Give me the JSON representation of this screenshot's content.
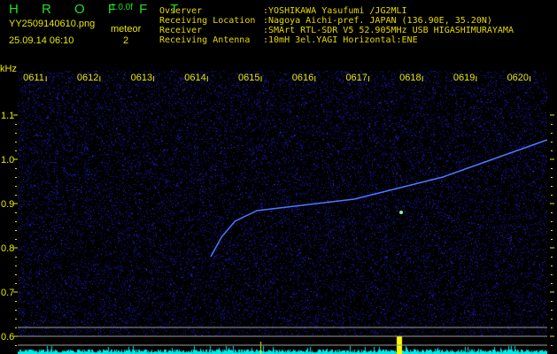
{
  "header": {
    "app": "H R O F F T",
    "version": "1.0.0f",
    "filename": "YY2509140610.png",
    "datetime": "25.09.14 06:10",
    "meteor_label": "meteor",
    "meteor_count": "2",
    "info": [
      {
        "label": "Ovserver",
        "value": ":YOSHIKAWA Yasufumi /JG2MLI"
      },
      {
        "label": "Receiving Location",
        "value": ":Nagoya Aichi-pref. JAPAN (136.90E, 35.20N)"
      },
      {
        "label": "Receiver",
        "value": ":SMArt RTL-SDR V5 52.905MHz USB HIGASHIMURAYAMA"
      },
      {
        "label": "Receiving Antenna",
        "value": ":10mH 3el.YAGI Horizontal:ENE"
      }
    ]
  },
  "colors": {
    "background": "#000000",
    "noise": "#1a1aa0",
    "trace": "#4a7aff",
    "text": "#e8e800",
    "histogram": "#00e8e8"
  },
  "chart_data": {
    "type": "heatmap",
    "ylabel": "kHz",
    "ylim": [
      0.56,
      1.2
    ],
    "yticks": [
      "1.1",
      "1.0",
      "0.9",
      "0.8",
      "0.7",
      "0.6"
    ],
    "ytick_values": [
      1.1,
      1.0,
      0.9,
      0.8,
      0.7,
      0.6
    ],
    "xticks": [
      "0611",
      "0612",
      "0613",
      "0614",
      "0615",
      "0616",
      "0617",
      "0618",
      "0619",
      "0620"
    ],
    "xlim_minutes": [
      10.47,
      20.32
    ],
    "meteor_trace": {
      "x_minutes": [
        14.06,
        14.26,
        14.51,
        14.92,
        16.73,
        18.38,
        20.32
      ],
      "kHz": [
        0.78,
        0.824,
        0.86,
        0.884,
        0.91,
        0.96,
        1.044
      ]
    },
    "reference_lines_kHz": [
      0.62,
      0.6,
      0.58
    ]
  }
}
